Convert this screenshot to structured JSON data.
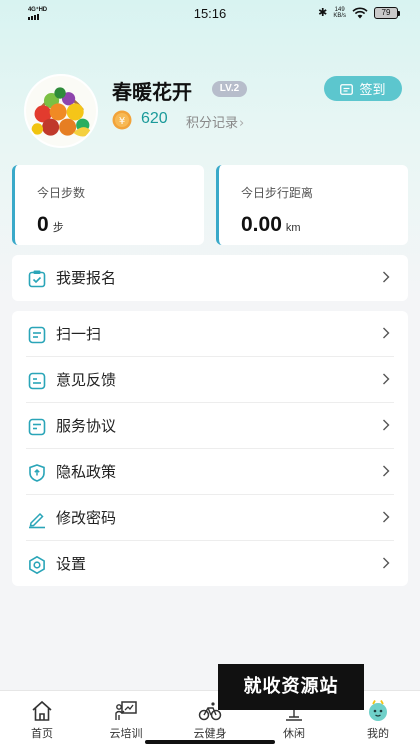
{
  "status_bar": {
    "network": "4G⁺HD",
    "time": "15:16",
    "speed_value": "149",
    "speed_unit": "KB/s",
    "battery": "79"
  },
  "profile": {
    "username": "春暖花开",
    "level": "LV.2",
    "points": "620",
    "points_record_label": "积分记录",
    "signin_label": "签到",
    "avatar_icon": "fruit-basket-avatar"
  },
  "stats": [
    {
      "label": "今日步数",
      "value": "0",
      "unit": "步"
    },
    {
      "label": "今日步行距离",
      "value": "0.00",
      "unit": "km"
    }
  ],
  "signup": {
    "label": "我要报名",
    "icon": "clipboard-check-icon"
  },
  "menu": [
    {
      "label": "扫一扫",
      "icon": "scan-icon"
    },
    {
      "label": "意见反馈",
      "icon": "feedback-icon"
    },
    {
      "label": "服务协议",
      "icon": "agreement-icon"
    },
    {
      "label": "隐私政策",
      "icon": "shield-icon"
    },
    {
      "label": "修改密码",
      "icon": "pen-icon"
    },
    {
      "label": "设置",
      "icon": "gear-icon"
    }
  ],
  "nav": [
    {
      "label": "首页",
      "icon": "home-icon"
    },
    {
      "label": "云培训",
      "icon": "training-icon"
    },
    {
      "label": "云健身",
      "icon": "fitness-icon"
    },
    {
      "label": "休闲",
      "icon": "leisure-icon"
    },
    {
      "label": "我的",
      "icon": "mine-icon",
      "active": true
    }
  ],
  "watermark": "就收资源站",
  "colors": {
    "accent": "#5cc6ce",
    "card_border": "#39a9c9",
    "points": "#1a9a9a",
    "icon": "#2aa5b8"
  }
}
